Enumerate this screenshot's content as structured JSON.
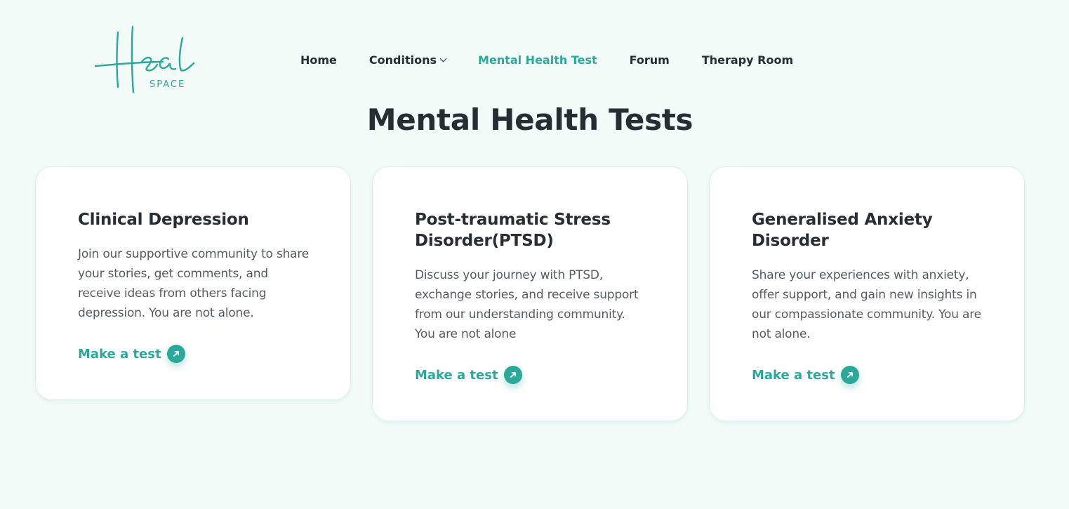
{
  "brand": {
    "logo_text": "Heal",
    "logo_subtext": "SPACE",
    "accent_color": "#2ba89c",
    "text_color": "#262d33",
    "background_color": "#f2fbf8"
  },
  "nav": {
    "items": [
      {
        "label": "Home"
      },
      {
        "label": "Conditions",
        "icon": "chevron-down-icon"
      },
      {
        "label": "Mental Health Test",
        "active": true
      },
      {
        "label": "Forum"
      },
      {
        "label": "Therapy Room"
      }
    ]
  },
  "page": {
    "title": "Mental Health Tests"
  },
  "cards": [
    {
      "title": "Clinical Depression",
      "description": "Join our supportive community to share your stories, get comments, and receive ideas from others facing depression. You are not alone.",
      "cta_label": "Make a test",
      "cta_icon": "arrow-up-right-icon"
    },
    {
      "title": "Post-traumatic Stress Disorder(PTSD)",
      "description": "Discuss your journey with PTSD, exchange stories, and receive support from our understanding community. You are not alone",
      "cta_label": "Make a test",
      "cta_icon": "arrow-up-right-icon"
    },
    {
      "title": "Generalised Anxiety Disorder",
      "description": "Share your experiences with anxiety, offer support, and gain new insights in our compassionate community. You are not alone.",
      "cta_label": "Make a test",
      "cta_icon": "arrow-up-right-icon"
    }
  ]
}
